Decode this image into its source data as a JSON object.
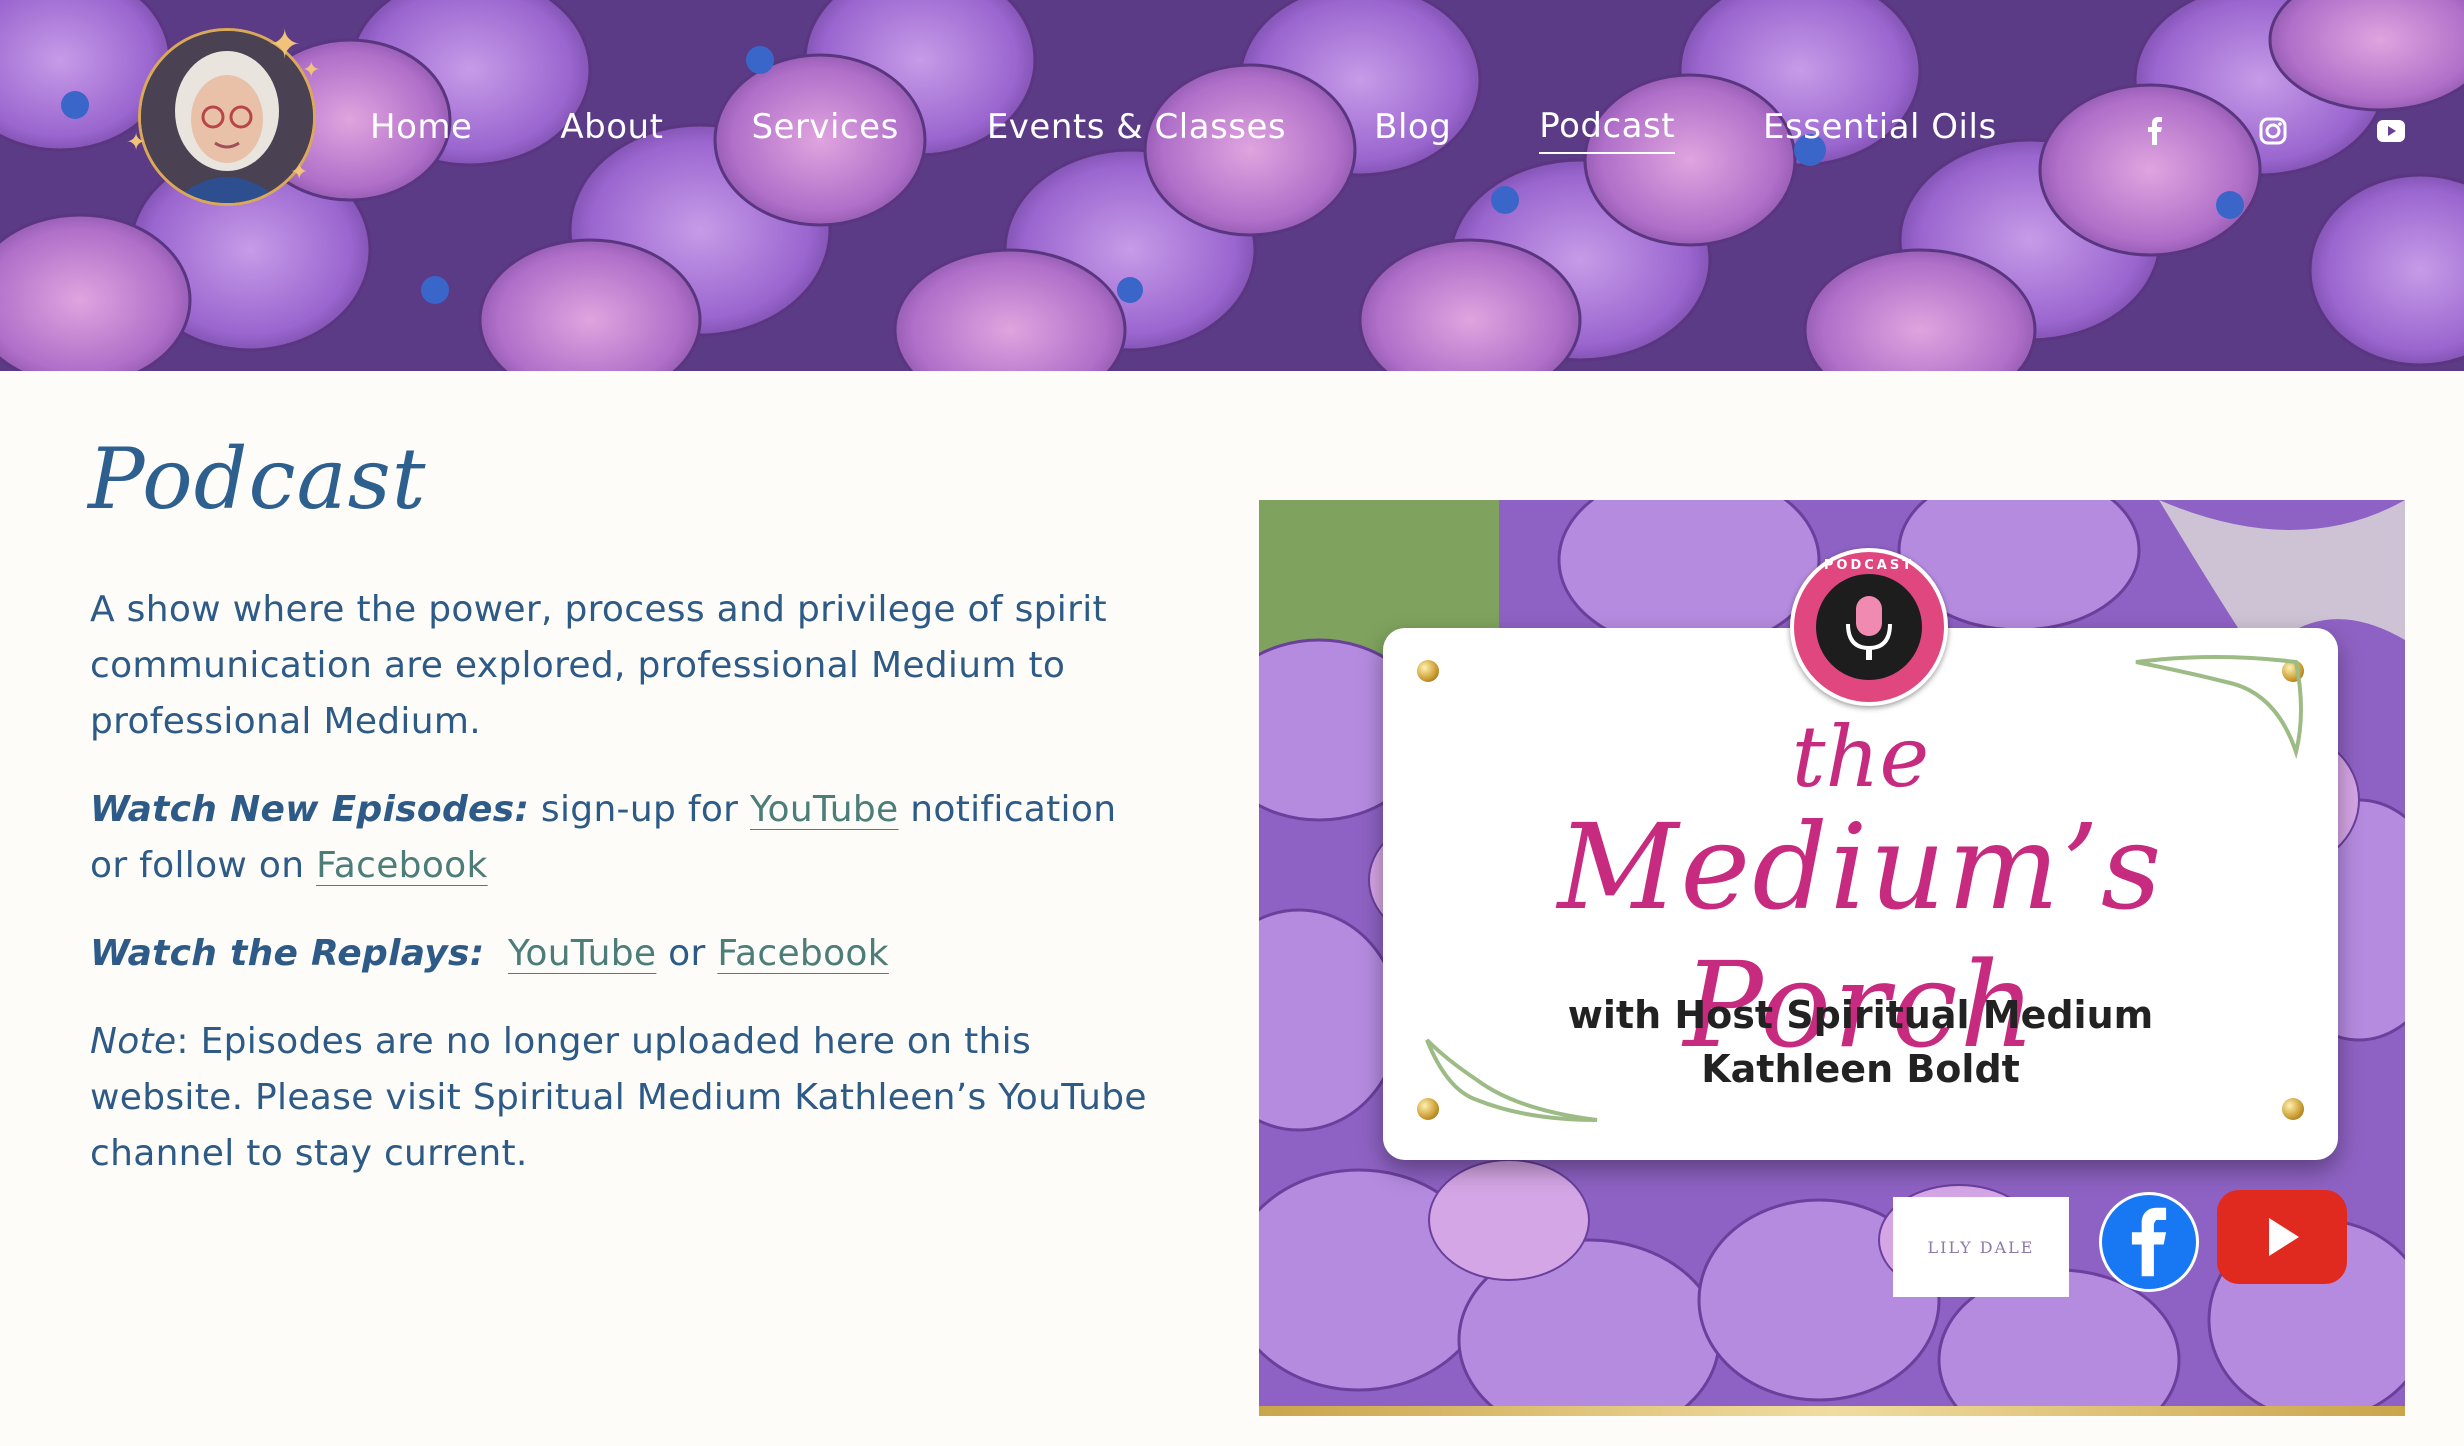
{
  "nav": {
    "items": [
      {
        "label": "Home",
        "active": false
      },
      {
        "label": "About",
        "active": false
      },
      {
        "label": "Services",
        "active": false
      },
      {
        "label": "Events & Classes",
        "active": false
      },
      {
        "label": "Blog",
        "active": false
      },
      {
        "label": "Podcast",
        "active": true
      },
      {
        "label": "Essential Oils",
        "active": false
      }
    ],
    "social": [
      "facebook-icon",
      "instagram-icon",
      "youtube-icon"
    ]
  },
  "main": {
    "title": "Podcast",
    "intro": "A show where the power, process and privilege of spirit communication are explored, professional Medium to professional Medium.",
    "watch_new": {
      "label": "Watch New Episodes:",
      "text1": " sign-up for ",
      "link1": "YouTube",
      "text2": " notification or follow on ",
      "link2": "Facebook"
    },
    "watch_replays": {
      "label": "Watch the Replays:",
      "link1": "YouTube",
      "text1": " or ",
      "link2": "Facebook"
    },
    "note": {
      "label": "Note",
      "text": ": Episodes are no longer uploaded here on this website. Please visit Spiritual Medium Kathleen’s YouTube channel to stay current."
    }
  },
  "podcast_art": {
    "badge": "PODCAST",
    "the": "the",
    "title": "Medium’s Porch",
    "host_line1": "with Host Spiritual Medium",
    "host_line2": "Kathleen Boldt",
    "partner_logo": "LILY DALE"
  },
  "colors": {
    "text": "#2d5a86",
    "link": "#4c7d78",
    "title": "#2d5f8f",
    "accent_pink": "#c72b7f",
    "background": "#fdfcf8"
  }
}
